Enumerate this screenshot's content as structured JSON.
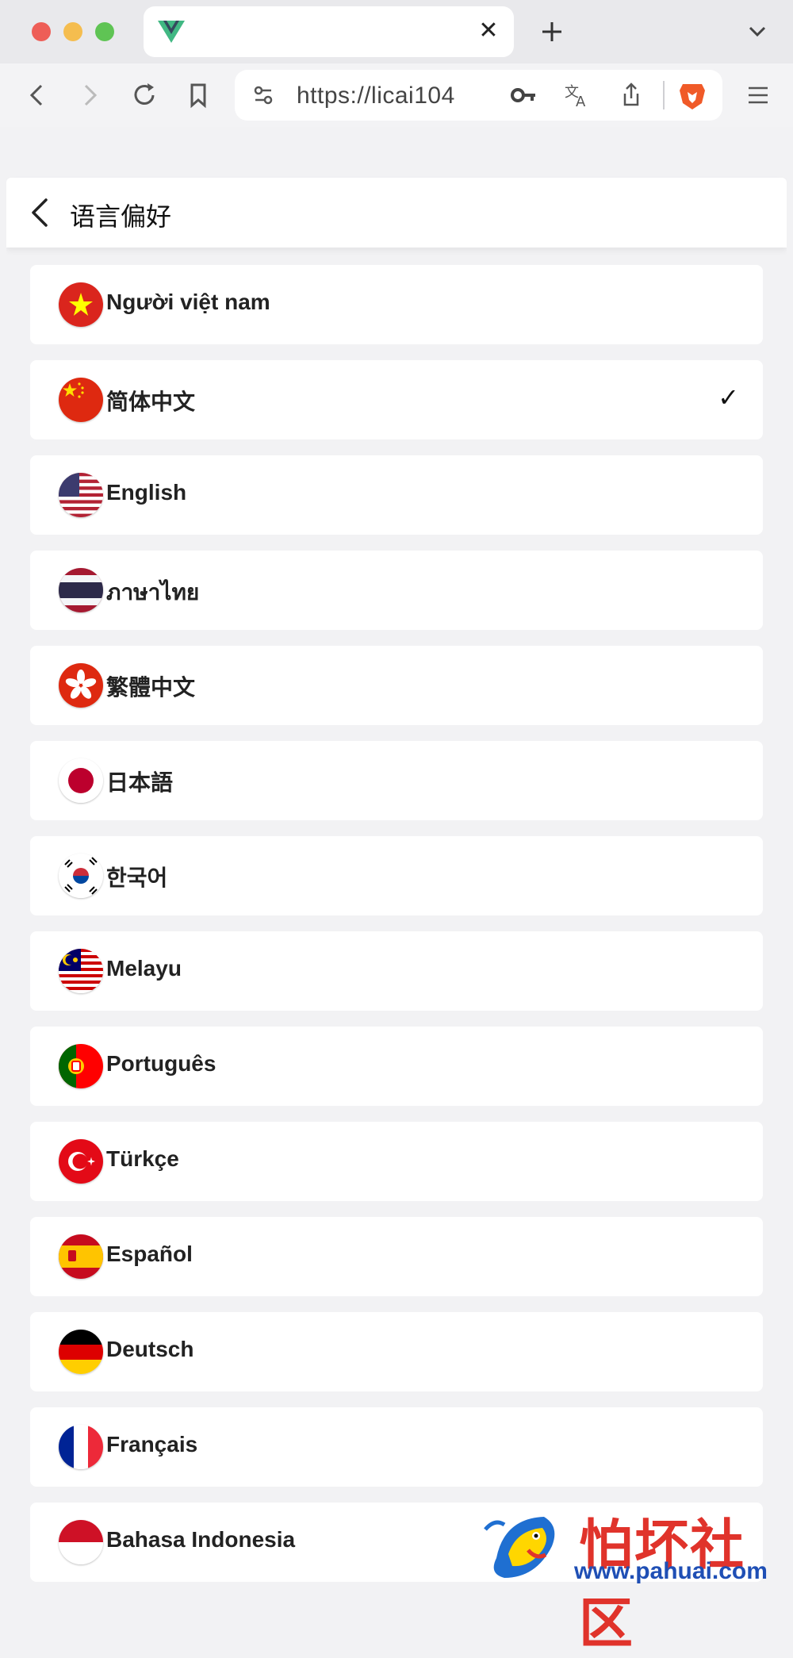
{
  "browser": {
    "url": "https://licai104",
    "colors": {
      "brave_orange": "#f05a28",
      "tab_bg": "#ffffff"
    },
    "icons": [
      "vue-favicon-icon",
      "close-icon",
      "plus-icon",
      "chevron-down-icon",
      "back-arrow-icon",
      "forward-arrow-icon",
      "reload-icon",
      "bookmark-icon",
      "site-settings-icon",
      "key-icon",
      "translate-icon",
      "share-icon",
      "brave-lion-icon",
      "hamburger-menu-icon"
    ]
  },
  "header": {
    "title": "语言偏好"
  },
  "languages": [
    {
      "label": "Người việt nam",
      "flag": "vn-flag-icon",
      "selected": false
    },
    {
      "label": "简体中文",
      "flag": "cn-flag-icon",
      "selected": true
    },
    {
      "label": "English",
      "flag": "us-flag-icon",
      "selected": false
    },
    {
      "label": "ภาษาไทย",
      "flag": "th-flag-icon",
      "selected": false
    },
    {
      "label": "繁體中文",
      "flag": "hk-flag-icon",
      "selected": false
    },
    {
      "label": "日本語",
      "flag": "jp-flag-icon",
      "selected": false
    },
    {
      "label": "한국어",
      "flag": "kr-flag-icon",
      "selected": false
    },
    {
      "label": "Melayu",
      "flag": "my-flag-icon",
      "selected": false
    },
    {
      "label": "Português",
      "flag": "pt-flag-icon",
      "selected": false
    },
    {
      "label": "Türkçe",
      "flag": "tr-flag-icon",
      "selected": false
    },
    {
      "label": "Español",
      "flag": "es-flag-icon",
      "selected": false
    },
    {
      "label": "Deutsch",
      "flag": "de-flag-icon",
      "selected": false
    },
    {
      "label": "Français",
      "flag": "fr-flag-icon",
      "selected": false
    },
    {
      "label": "Bahasa Indonesia",
      "flag": "id-flag-icon",
      "selected": false
    }
  ],
  "check_mark": "✓",
  "watermark": {
    "title": "怕坏社区",
    "url": "www.pahuai.com"
  }
}
